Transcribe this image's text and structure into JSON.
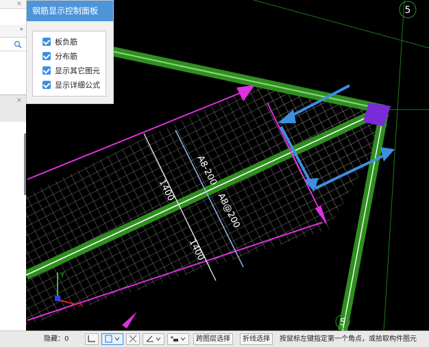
{
  "left_strip": {
    "close_icon_1": "×",
    "close_icon_2": "×",
    "collapse_icon": "»",
    "search_icon": "search-icon"
  },
  "panel": {
    "title": "钢筋显示控制面板",
    "options": [
      {
        "label": "板负筋",
        "checked": true
      },
      {
        "label": "分布筋",
        "checked": true
      },
      {
        "label": "显示其它图元",
        "checked": true
      },
      {
        "label": "显示详细公式",
        "checked": true
      }
    ]
  },
  "canvas": {
    "axis_label_top": "5",
    "axis_label_bottom": "5",
    "dim_upper": "1400",
    "dim_lower": "1400",
    "rebar_label_1": "A8-200",
    "rebar_label_2": "A8@200",
    "coord_x": "X",
    "coord_y": "Y",
    "colors": {
      "green_beam": "#2f8f1f",
      "magenta": "#e030e0",
      "blue_arrow": "#3d8fe0",
      "column": "#7b2bd6"
    }
  },
  "statusbar": {
    "hidden_label": "隐藏：0",
    "layer_select": "跨图层选择",
    "polyline_select": "折线选择",
    "hint": "按鼠标左键指定第一个角点，或拾取构件图元"
  }
}
